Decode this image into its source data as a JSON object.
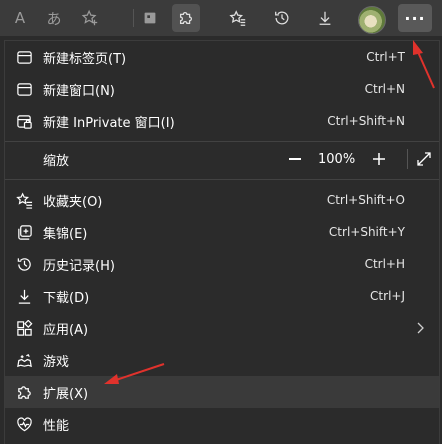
{
  "menu": {
    "new_tab": {
      "label": "新建标签页(T)",
      "shortcut": "Ctrl+T"
    },
    "new_window": {
      "label": "新建窗口(N)",
      "shortcut": "Ctrl+N"
    },
    "new_inprivate": {
      "label": "新建 InPrivate 窗口(I)",
      "shortcut": "Ctrl+Shift+N"
    },
    "zoom": {
      "label": "缩放",
      "minus": "—",
      "value": "100%",
      "plus": "+"
    },
    "favorites": {
      "label": "收藏夹(O)",
      "shortcut": "Ctrl+Shift+O"
    },
    "collections": {
      "label": "集锦(E)",
      "shortcut": "Ctrl+Shift+Y"
    },
    "history": {
      "label": "历史记录(H)",
      "shortcut": "Ctrl+H"
    },
    "downloads": {
      "label": "下载(D)",
      "shortcut": "Ctrl+J"
    },
    "apps": {
      "label": "应用(A)"
    },
    "games": {
      "label": "游戏"
    },
    "extensions": {
      "label": "扩展(X)"
    },
    "performance": {
      "label": "性能"
    }
  },
  "toolbar": {
    "read_aloud_glyph": "A",
    "translate_glyph": "あ",
    "more_glyph": "···"
  },
  "colors": {
    "annotation": "#e0322c",
    "toolbar_bg": "#3b3b3b",
    "menu_bg": "#2b2b2b"
  }
}
